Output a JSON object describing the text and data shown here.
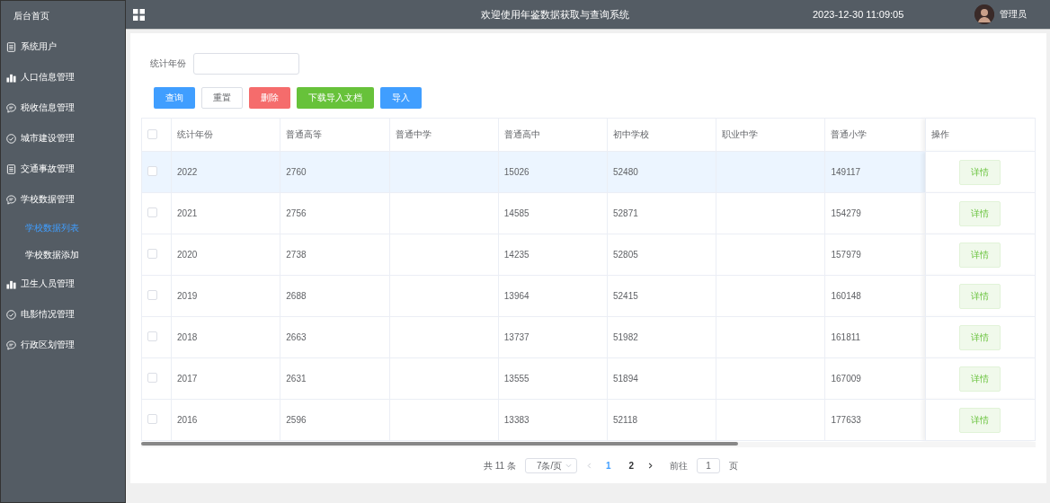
{
  "sidebar": {
    "title": "后台首页",
    "items": [
      {
        "label": "系统用户",
        "kind": "doc"
      },
      {
        "label": "人口信息管理",
        "kind": "bars"
      },
      {
        "label": "税收信息管理",
        "kind": "chat"
      },
      {
        "label": "城市建设管理",
        "kind": "check"
      },
      {
        "label": "交通事故管理",
        "kind": "doc"
      },
      {
        "label": "学校数据管理",
        "kind": "chat",
        "children": [
          {
            "label": "学校数据列表",
            "selected": true
          },
          {
            "label": "学校数据添加",
            "selected": false
          }
        ]
      },
      {
        "label": "卫生人员管理",
        "kind": "bars"
      },
      {
        "label": "电影情况管理",
        "kind": "check"
      },
      {
        "label": "行政区划管理",
        "kind": "chat"
      }
    ]
  },
  "header": {
    "title": "欢迎使用年鉴数据获取与查询系统",
    "datetime": "2023-12-30 11:09:05",
    "user": "管理员"
  },
  "filter": {
    "label": "统计年份"
  },
  "buttons": [
    {
      "label": "查询",
      "kind": "primary"
    },
    {
      "label": "重置",
      "kind": "default"
    },
    {
      "label": "删除",
      "kind": "danger"
    },
    {
      "label": "下载导入文档",
      "kind": "success"
    },
    {
      "label": "导入",
      "kind": "primary"
    }
  ],
  "table": {
    "columns": [
      "统计年份",
      "普通高等",
      "普通中学",
      "普通高中",
      "初中学校",
      "职业中学",
      "普通小学"
    ],
    "action_column": "操作",
    "header_checked": false,
    "rows": [
      {
        "checked": false,
        "highlighted": true,
        "cells": [
          "2022",
          "2760",
          "",
          "15026",
          "52480",
          "",
          "149117"
        ],
        "action": "详情"
      },
      {
        "checked": false,
        "highlighted": false,
        "cells": [
          "2021",
          "2756",
          "",
          "14585",
          "52871",
          "",
          "154279"
        ],
        "action": "详情"
      },
      {
        "checked": false,
        "highlighted": false,
        "cells": [
          "2020",
          "2738",
          "",
          "14235",
          "52805",
          "",
          "157979"
        ],
        "action": "详情"
      },
      {
        "checked": false,
        "highlighted": false,
        "cells": [
          "2019",
          "2688",
          "",
          "13964",
          "52415",
          "",
          "160148"
        ],
        "action": "详情"
      },
      {
        "checked": false,
        "highlighted": false,
        "cells": [
          "2018",
          "2663",
          "",
          "13737",
          "51982",
          "",
          "161811"
        ],
        "action": "详情"
      },
      {
        "checked": false,
        "highlighted": false,
        "cells": [
          "2017",
          "2631",
          "",
          "13555",
          "51894",
          "",
          "167009"
        ],
        "action": "详情"
      },
      {
        "checked": false,
        "highlighted": false,
        "cells": [
          "2016",
          "2596",
          "",
          "13383",
          "52118",
          "",
          "177633"
        ],
        "action": "详情"
      }
    ]
  },
  "pagination": {
    "total": "共 11 条",
    "page_size": "7条/页",
    "pages": [
      {
        "label": "1",
        "selected": true
      },
      {
        "label": "2",
        "selected": false
      }
    ],
    "jump_label": "前往",
    "jump_value": "1",
    "jump_suffix": "页"
  }
}
